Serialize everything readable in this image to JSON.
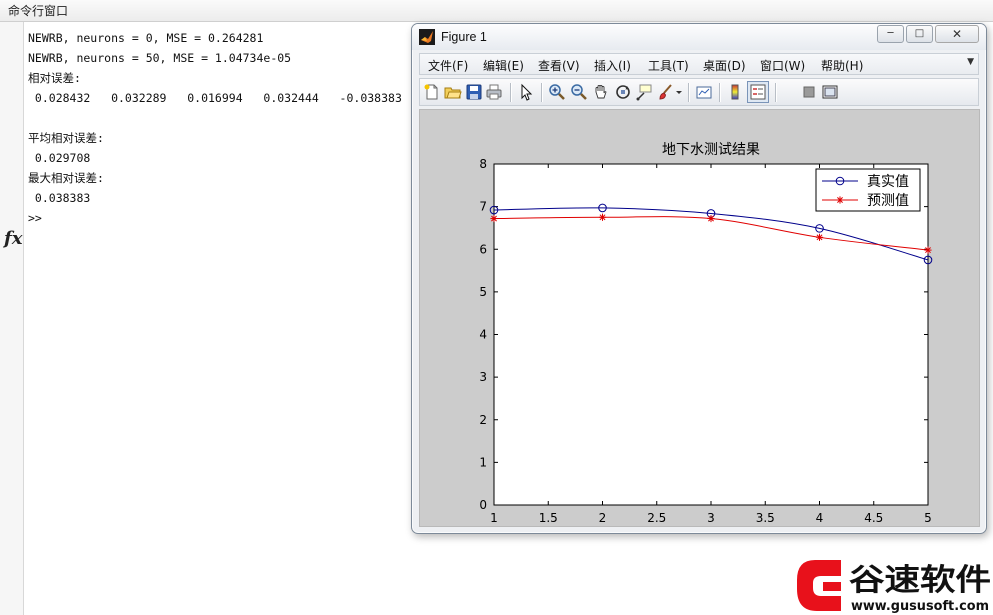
{
  "command_window": {
    "title": "命令行窗口",
    "lines": [
      "NEWRB, neurons = 0, MSE = 0.264281",
      "NEWRB, neurons = 50, MSE = 1.04734e-05",
      "相对误差:",
      " 0.028432   0.032289   0.016994   0.032444   -0.038383",
      "",
      "平均相对误差:",
      " 0.029708",
      "最大相对误差:",
      " 0.038383"
    ],
    "fx_label": "fx",
    "prompt": ">>"
  },
  "figure": {
    "title": "Figure 1",
    "menu": [
      "文件(F)",
      "编辑(E)",
      "查看(V)",
      "插入(I)",
      "工具(T)",
      "桌面(D)",
      "窗口(W)",
      "帮助(H)"
    ],
    "toolbar_icons": [
      "new-figure",
      "open-file",
      "save",
      "print",
      "select-arrow",
      "zoom-in",
      "zoom-out",
      "pan-hand",
      "rotate-3d",
      "data-cursor",
      "brush",
      "link-plot",
      "insert-colorbar",
      "insert-legend",
      "hide-plot-tools",
      "show-plot-tools"
    ]
  },
  "chart_data": {
    "type": "line",
    "title": "地下水测试结果",
    "xlabel": "",
    "ylabel": "",
    "xlim": [
      1,
      5
    ],
    "ylim": [
      0,
      8
    ],
    "xticks": [
      1,
      1.5,
      2,
      2.5,
      3,
      3.5,
      4,
      4.5,
      5
    ],
    "yticks": [
      0,
      1,
      2,
      3,
      4,
      5,
      6,
      7,
      8
    ],
    "grid": false,
    "legend_position": "top-right",
    "x": [
      1,
      2,
      3,
      4,
      5
    ],
    "series": [
      {
        "name": "真实值",
        "values": [
          6.92,
          6.97,
          6.84,
          6.49,
          5.75
        ],
        "color": "#00008b",
        "marker": "circle"
      },
      {
        "name": "预测值",
        "values": [
          6.72,
          6.75,
          6.72,
          6.28,
          5.98
        ],
        "color": "#e00000",
        "marker": "asterisk"
      }
    ]
  },
  "watermark": {
    "brand": "谷速软件",
    "url": "www.gususoft.com",
    "color": "#e8111b"
  }
}
